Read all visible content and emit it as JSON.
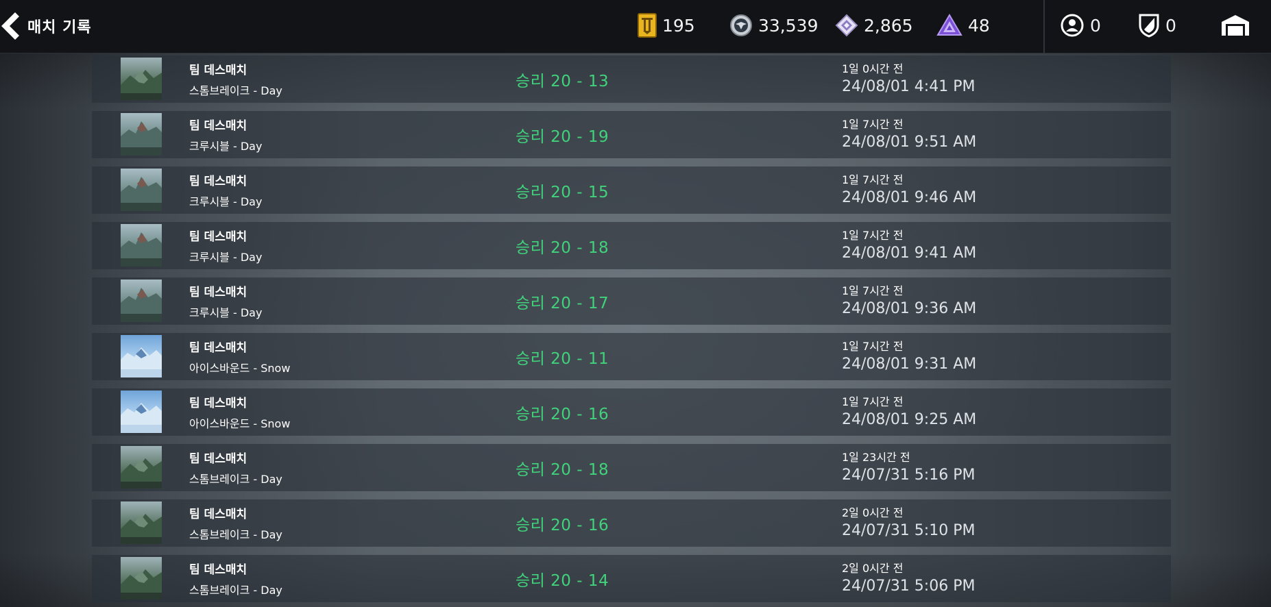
{
  "header": {
    "title": "매치 기록",
    "currencies": [
      {
        "icon": "gold-pass-icon",
        "value": "195"
      },
      {
        "icon": "silver-coin-icon",
        "value": "33,539"
      },
      {
        "icon": "diamond-token-icon",
        "value": "2,865"
      },
      {
        "icon": "purple-triangle-icon",
        "value": "48"
      }
    ],
    "right_counters": [
      {
        "icon": "profile-icon",
        "value": "0"
      },
      {
        "icon": "shield-icon",
        "value": "0"
      }
    ],
    "garage_icon": "garage-icon"
  },
  "matches": [
    {
      "mode": "팀 데스매치",
      "map": "스톰브레이크 - Day",
      "thumb": "stormbreak",
      "result": "승리 20 - 13",
      "ago": "1일 0시간 전",
      "date": "24/08/01 4:41 PM"
    },
    {
      "mode": "팀 데스매치",
      "map": "크루시블 - Day",
      "thumb": "crucible",
      "result": "승리 20 - 19",
      "ago": "1일 7시간 전",
      "date": "24/08/01 9:51 AM"
    },
    {
      "mode": "팀 데스매치",
      "map": "크루시블 - Day",
      "thumb": "crucible",
      "result": "승리 20 - 15",
      "ago": "1일 7시간 전",
      "date": "24/08/01 9:46 AM"
    },
    {
      "mode": "팀 데스매치",
      "map": "크루시블 - Day",
      "thumb": "crucible",
      "result": "승리 20 - 18",
      "ago": "1일 7시간 전",
      "date": "24/08/01 9:41 AM"
    },
    {
      "mode": "팀 데스매치",
      "map": "크루시블 - Day",
      "thumb": "crucible",
      "result": "승리 20 - 17",
      "ago": "1일 7시간 전",
      "date": "24/08/01 9:36 AM"
    },
    {
      "mode": "팀 데스매치",
      "map": "아이스바운드 - Snow",
      "thumb": "icebound",
      "result": "승리 20 - 11",
      "ago": "1일 7시간 전",
      "date": "24/08/01 9:31 AM"
    },
    {
      "mode": "팀 데스매치",
      "map": "아이스바운드 - Snow",
      "thumb": "icebound",
      "result": "승리 20 - 16",
      "ago": "1일 7시간 전",
      "date": "24/08/01 9:25 AM"
    },
    {
      "mode": "팀 데스매치",
      "map": "스톰브레이크 - Day",
      "thumb": "stormbreak",
      "result": "승리 20 - 18",
      "ago": "1일 23시간 전",
      "date": "24/07/31 5:16 PM"
    },
    {
      "mode": "팀 데스매치",
      "map": "스톰브레이크 - Day",
      "thumb": "stormbreak",
      "result": "승리 20 - 16",
      "ago": "2일 0시간 전",
      "date": "24/07/31 5:10 PM"
    },
    {
      "mode": "팀 데스매치",
      "map": "스톰브레이크 - Day",
      "thumb": "stormbreak",
      "result": "승리 20 - 14",
      "ago": "2일 0시간 전",
      "date": "24/07/31 5:06 PM"
    }
  ],
  "colors": {
    "win_green": "#41d27c",
    "topbar_bg": "#111316",
    "row_bg": "rgba(42,48,56,0.62)"
  }
}
